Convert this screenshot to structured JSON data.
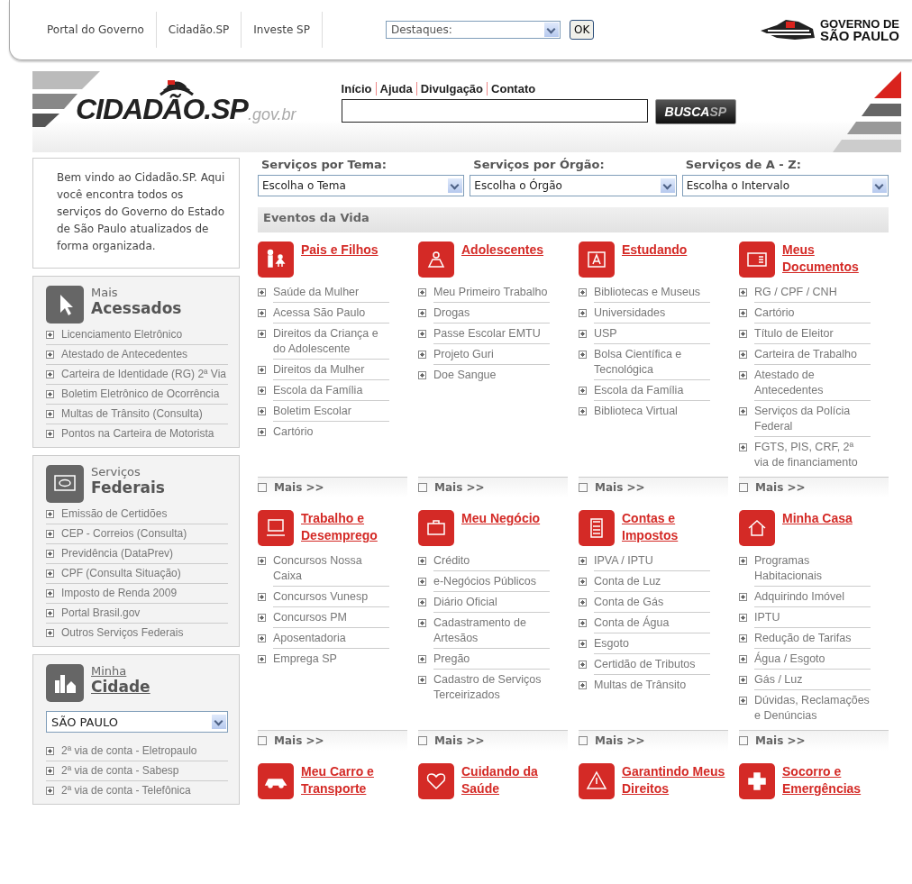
{
  "top_bar": {
    "links": [
      "Portal do Governo",
      "Cidadão.SP",
      "Investe SP"
    ],
    "select": "Destaques:",
    "ok_button": "OK",
    "logo_lines": [
      "GOVERNO DE",
      "SÃO PAULO"
    ]
  },
  "header": {
    "logo": "CIDADÃO.SP",
    "logo_suffix": ".gov.br",
    "nav": [
      "Início",
      "Ajuda",
      "Divulgação",
      "Contato"
    ],
    "search_button": [
      "BUSCA",
      "SP"
    ]
  },
  "sidebar": {
    "welcome": "Bem vindo ao Cidadão.SP. Aqui você encontra todos os serviços do Governo do Estado de São Paulo atualizados de forma organizada.",
    "panels": [
      {
        "kind": "list",
        "title_small": "Mais",
        "title_big": "Acessados",
        "items": [
          "Licenciamento Eletrônico",
          "Atestado de Antecedentes",
          "Carteira de Identidade (RG) 2ª Via",
          "Boletim Eletrônico de Ocorrência",
          "Multas de Trânsito (Consulta)",
          "Pontos na Carteira de Motorista"
        ]
      },
      {
        "kind": "list",
        "title_small": "Serviços",
        "title_big": "Federais",
        "items": [
          "Emissão de Certidões",
          "CEP - Correios (Consulta)",
          "Previdência (DataPrev)",
          "CPF (Consulta Situação)",
          "Imposto de Renda 2009",
          "Portal Brasil.gov",
          "Outros Serviços Federais"
        ]
      },
      {
        "kind": "city",
        "title_small": "Minha",
        "title_big": "Cidade",
        "select": "SÃO PAULO",
        "items": [
          "2ª via de conta - Eletropaulo",
          "2ª via de conta - Sabesp",
          "2ª via de conta - Telefônica"
        ]
      }
    ]
  },
  "filters": [
    {
      "label": "Serviços por Tema:",
      "select": "Escolha o Tema"
    },
    {
      "label": "Serviços por Órgão:",
      "select": "Escolha o Órgão"
    },
    {
      "label": "Serviços de A - Z:",
      "select": "Escolha o Intervalo"
    }
  ],
  "section_title": "Eventos da Vida",
  "categories": [
    {
      "title": "Pais e Filhos",
      "items": [
        "Saúde da Mulher",
        "Acessa São Paulo",
        "Direitos da Criança e do Adolescente",
        "Direitos da Mulher",
        "Escola da Família",
        "Boletim Escolar",
        "Cartório"
      ],
      "more": "Mais >>"
    },
    {
      "title": "Adolescentes",
      "items": [
        "Meu Primeiro Trabalho",
        "Drogas",
        "Passe Escolar EMTU",
        "Projeto Guri",
        "Doe Sangue"
      ],
      "more": "Mais >>"
    },
    {
      "title": "Estudando",
      "items": [
        "Bibliotecas e Museus",
        "Universidades",
        "USP",
        "Bolsa Científica e Tecnológica",
        "Escola da Família",
        "Biblioteca Virtual"
      ],
      "more": "Mais >>"
    },
    {
      "title": "Meus Documentos",
      "items": [
        "RG / CPF / CNH",
        "Cartório",
        "Título de Eleitor",
        "Carteira de Trabalho",
        "Atestado de Antecedentes",
        "Serviços da Polícia Federal",
        "FGTS, PIS, CRF, 2ª via de financiamento"
      ],
      "more": "Mais >>"
    },
    {
      "title": "Trabalho e Desemprego",
      "items": [
        "Concursos Nossa Caixa",
        "Concursos Vunesp",
        "Concursos PM",
        "Aposentadoria",
        "Emprega SP"
      ],
      "more": "Mais >>"
    },
    {
      "title": "Meu Negócio",
      "items": [
        "Crédito",
        "e-Negócios Públicos",
        "Diário Oficial",
        "Cadastramento de Artesãos",
        "Pregão",
        "Cadastro de Serviços Terceirizados"
      ],
      "more": "Mais >>"
    },
    {
      "title": "Contas e Impostos",
      "items": [
        "IPVA / IPTU",
        "Conta de Luz",
        "Conta de Gás",
        "Conta de Água",
        "Esgoto",
        "Certidão de Tributos",
        "Multas de Trânsito"
      ],
      "more": "Mais >>"
    },
    {
      "title": "Minha Casa",
      "items": [
        "Programas Habitacionais",
        "Adquirindo Imóvel",
        "IPTU",
        "Redução de Tarifas",
        "Água / Esgoto",
        "Gás / Luz",
        "Dúvidas, Reclamações e Denúncias"
      ],
      "more": "Mais >>"
    },
    {
      "title": "Meu Carro e Transporte"
    },
    {
      "title": "Cuidando da Saúde"
    },
    {
      "title": "Garantindo Meus Direitos"
    },
    {
      "title": "Socorro e Emergências"
    }
  ]
}
